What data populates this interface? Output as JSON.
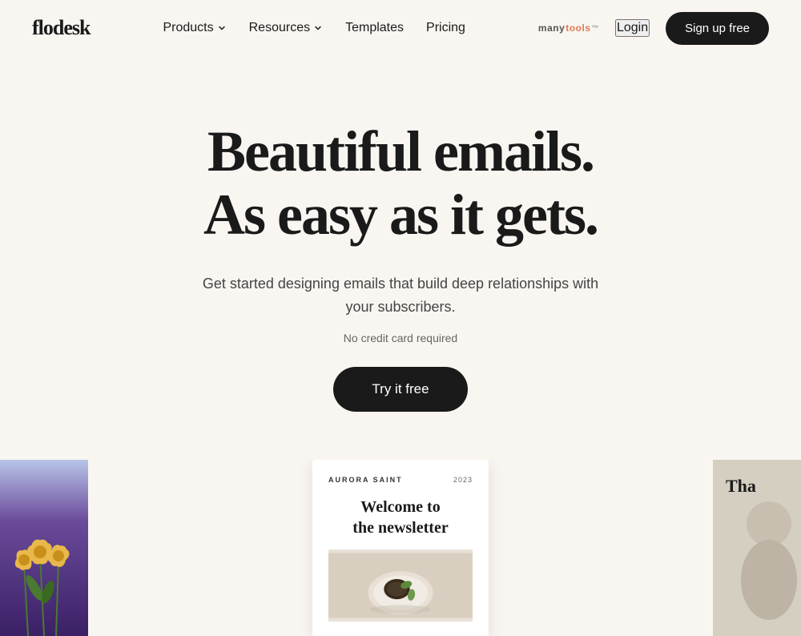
{
  "manytools": {
    "label_many": "many",
    "label_tools": "tools",
    "tm": "™"
  },
  "header": {
    "logo": "flodesk",
    "nav": [
      {
        "label": "Products",
        "has_dropdown": true
      },
      {
        "label": "Resources",
        "has_dropdown": true
      },
      {
        "label": "Templates",
        "has_dropdown": false
      },
      {
        "label": "Pricing",
        "has_dropdown": false
      }
    ],
    "login_label": "Login",
    "signup_label": "Sign up free"
  },
  "hero": {
    "title_line1": "Beautiful emails.",
    "title_line2": "As easy as it gets.",
    "subtitle": "Get started designing emails that build deep relationships with your subscribers.",
    "no_credit_label": "No credit card required",
    "cta_label": "Try it free"
  },
  "preview": {
    "left_bg": "#7a5fa0",
    "center": {
      "brand": "AURORA SAINT",
      "year": "2023",
      "title_line1": "Welcome to",
      "title_line2": "the newsletter"
    },
    "right_partial": "Tha"
  }
}
